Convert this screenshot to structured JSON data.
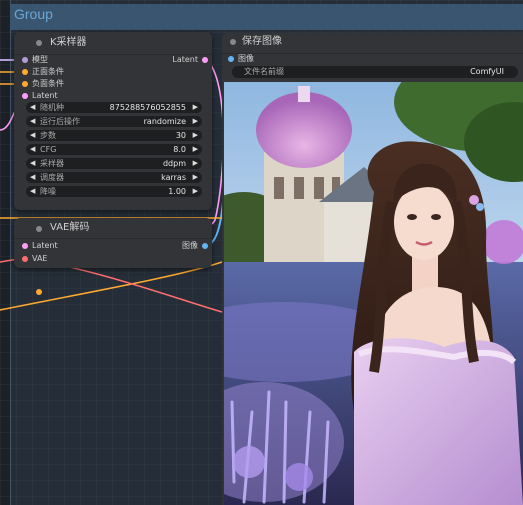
{
  "group": {
    "title": "Group"
  },
  "ksampler": {
    "title": "K采样器",
    "inputs": [
      "模型",
      "正面条件",
      "负面条件",
      "Latent"
    ],
    "output": "Latent",
    "widgets": [
      {
        "label": "随机种",
        "value": "875288576052855"
      },
      {
        "label": "运行后操作",
        "value": "randomize"
      },
      {
        "label": "步数",
        "value": "30"
      },
      {
        "label": "CFG",
        "value": "8.0"
      },
      {
        "label": "采样器",
        "value": "ddpm"
      },
      {
        "label": "调度器",
        "value": "karras"
      },
      {
        "label": "降噪",
        "value": "1.00"
      }
    ]
  },
  "vae_decode": {
    "title": "VAE解码",
    "inputs": [
      "Latent",
      "VAE"
    ],
    "output": "图像"
  },
  "save_image": {
    "title": "保存图像",
    "input": "图像",
    "filename_label": "文件名前缀",
    "filename_value": "ComfyUI"
  },
  "colors": {
    "model": "#b39ddb",
    "conditioning": "#ffa931",
    "latent": "#ff9cf9",
    "vae": "#ff6e6e",
    "image": "#64b5f6"
  }
}
